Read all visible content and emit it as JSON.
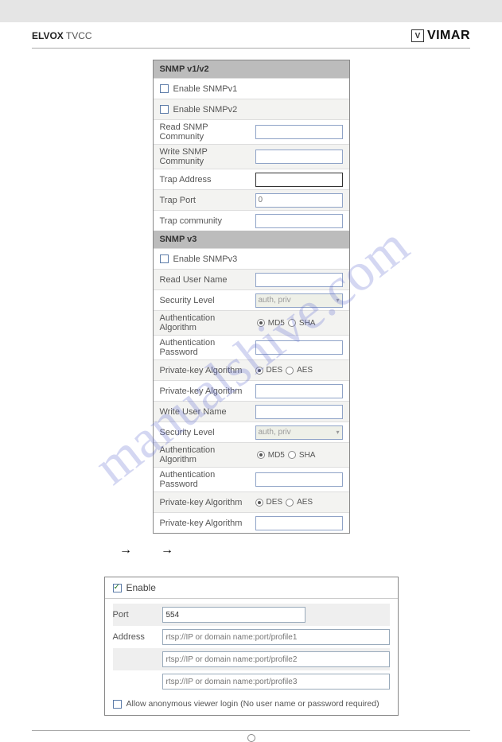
{
  "header": {
    "brand_bold": "ELVOX",
    "brand_rest": " TVCC",
    "vendor": "VIMAR"
  },
  "watermark": "manualshive.com",
  "snmp12": {
    "title": "SNMP v1/v2",
    "enable_v1": "Enable SNMPv1",
    "enable_v2": "Enable SNMPv2",
    "read_community": "Read SNMP Community",
    "write_community": "Write SNMP Community",
    "trap_address": "Trap Address",
    "trap_port": "Trap Port",
    "trap_port_value": "0",
    "trap_community": "Trap community"
  },
  "snmp3": {
    "title": "SNMP v3",
    "enable_v3": "Enable SNMPv3",
    "read_user": "Read User Name",
    "sec_level": "Security Level",
    "sec_level_value": "auth, priv",
    "auth_algo": "Authentication Algorithm",
    "md5": "MD5",
    "sha": "SHA",
    "auth_pass": "Authentication Password",
    "priv_algo": "Private-key Algorithm",
    "des": "DES",
    "aes": "AES",
    "priv_algo2": "Private-key Algorithm",
    "write_user": "Write User Name",
    "sec_level2": "Security Level",
    "sec_level2_value": "auth, priv",
    "auth_algo2": "Authentication Algorithm",
    "auth_pass2": "Authentication Password",
    "priv_algo3": "Private-key Algorithm",
    "priv_algo4": "Private-key Algorithm"
  },
  "rtsp": {
    "enable": "Enable",
    "port_label": "Port",
    "port_value": "554",
    "address_label": "Address",
    "addr1": "rtsp://IP or domain name:port/profile1",
    "addr2": "rtsp://IP or domain name:port/profile2",
    "addr3": "rtsp://IP or domain name:port/profile3",
    "anon": "Allow anonymous viewer login (No user name or password required)"
  }
}
